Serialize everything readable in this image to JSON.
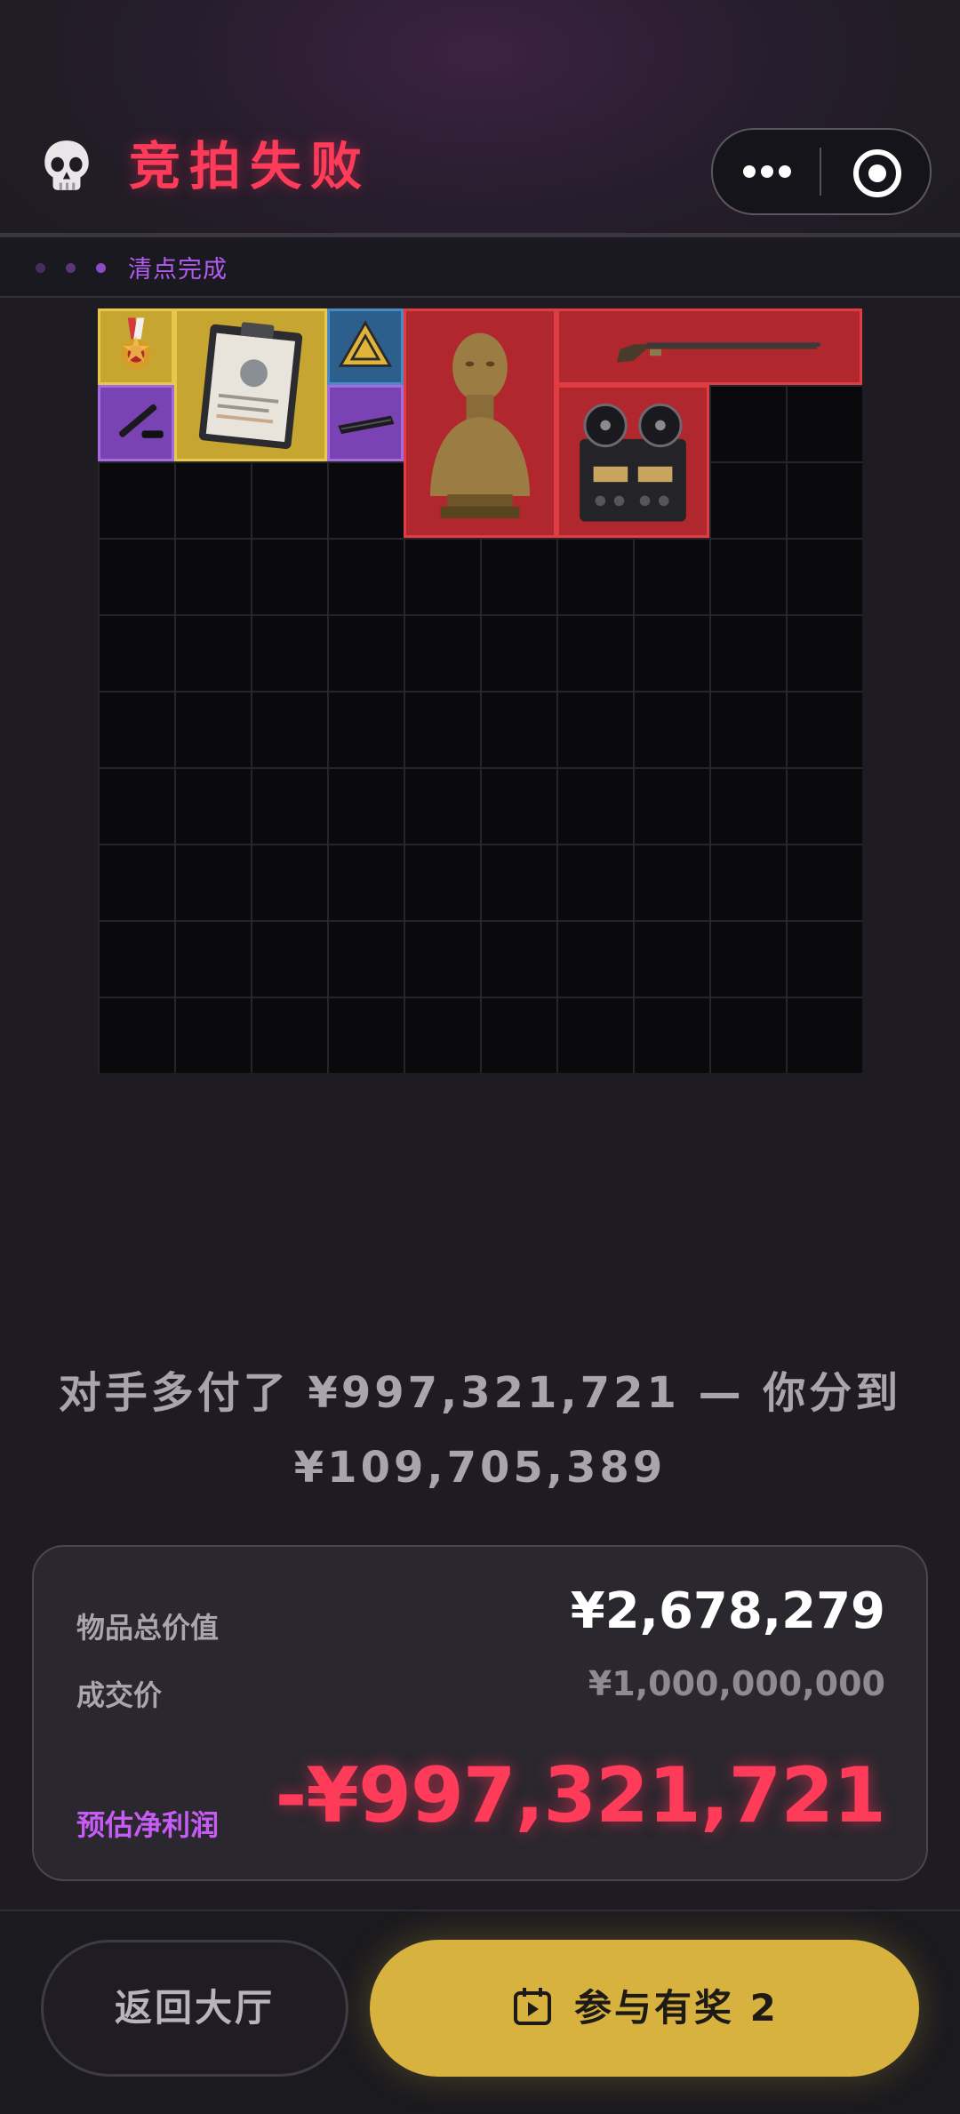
{
  "header": {
    "title": "竞拍失败",
    "skull_icon": "skull-icon"
  },
  "capsule": {
    "more_icon": "more-dots-icon",
    "target_icon": "target-icon"
  },
  "status": {
    "text": "清点完成",
    "dot_colors": [
      "#4a2d5e",
      "#5d3478",
      "#8b4bc4"
    ]
  },
  "grid": {
    "columns": 10,
    "rows": 10,
    "items": [
      {
        "name": "medal",
        "rarity": "gold"
      },
      {
        "name": "clipboard-document",
        "rarity": "gold"
      },
      {
        "name": "warning-sign",
        "rarity": "blue"
      },
      {
        "name": "pen",
        "rarity": "purple"
      },
      {
        "name": "rolled-item",
        "rarity": "purple"
      },
      {
        "name": "bronze-bust",
        "rarity": "red"
      },
      {
        "name": "flintlock-rifle",
        "rarity": "red"
      },
      {
        "name": "reel-tape-recorder",
        "rarity": "red"
      }
    ]
  },
  "message": {
    "line1": "对手多付了 ¥997,321,721 — 你分到",
    "line2": "¥109,705,389"
  },
  "summary": {
    "total_value_label": "物品总价值",
    "total_value": "¥2,678,279",
    "deal_price_label": "成交价",
    "deal_price": "¥1,000,000,000",
    "profit_label": "预估净利润",
    "profit": "-¥997,321,721"
  },
  "buttons": {
    "lobby_label": "返回大厅",
    "join_label": "参与有奖 2",
    "join_icon": "calendar-play-icon"
  },
  "colors": {
    "accent_red": "#ff3b5a",
    "accent_purple": "#b35cf0",
    "gold": "#d7b23f",
    "background": "#1e1c22"
  }
}
